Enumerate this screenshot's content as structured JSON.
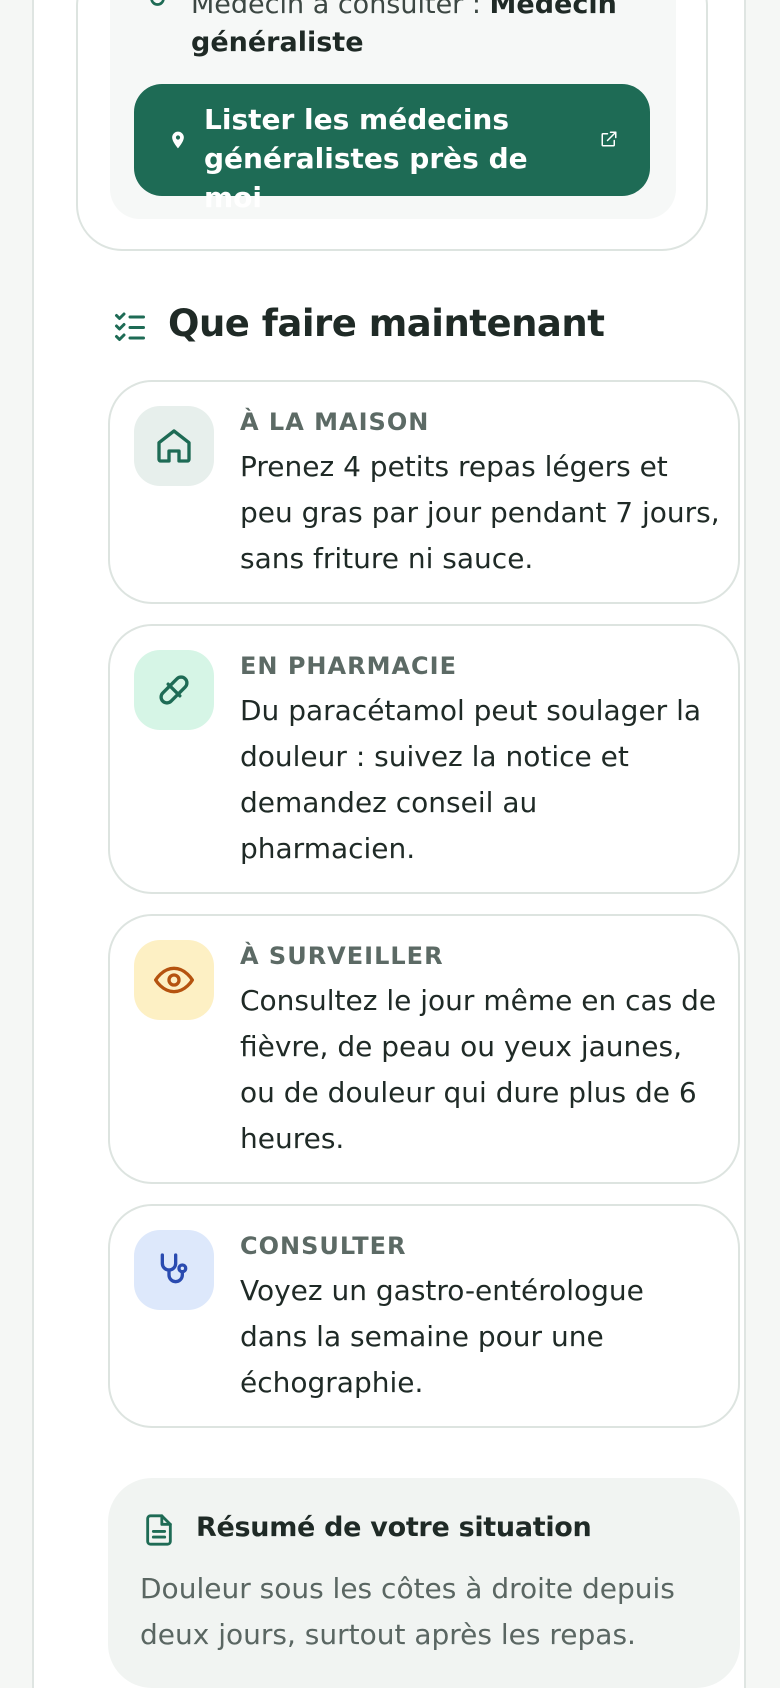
{
  "doctor_card": {
    "prefix": "Médecin à consulter : ",
    "specialty": "Médecin généraliste",
    "cta_label": "Lister les médecins généralistes près de moi"
  },
  "section": {
    "title": "Que faire maintenant"
  },
  "actions": [
    {
      "kicker": "À LA MAISON",
      "text": "Prenez 4 petits repas légers et peu gras par jour pendant 7 jours, sans friture ni sauce.",
      "icon": "home-icon",
      "icon_bg": "#e7efec",
      "icon_color": "#1e6b55"
    },
    {
      "kicker": "EN PHARMACIE",
      "text": "Du paracétamol peut soulager la douleur : suivez la notice et demandez conseil au pharmacien.",
      "icon": "pill-icon",
      "icon_bg": "#d6f5e6",
      "icon_color": "#1e6b55"
    },
    {
      "kicker": "À SURVEILLER",
      "text": "Consultez le jour même en cas de fièvre, de peau ou yeux jaunes, ou de douleur qui dure plus de 6 heures.",
      "icon": "eye-icon",
      "icon_bg": "#fdf0c4",
      "icon_color": "#b5530f"
    },
    {
      "kicker": "CONSULTER",
      "text": "Voyez un gastro-entérologue dans la semaine pour une échographie.",
      "icon": "stethoscope-icon",
      "icon_bg": "#dde8fb",
      "icon_color": "#2a4bb0"
    }
  ],
  "summary": {
    "title": "Résumé de votre situation",
    "text": "Douleur sous les côtes à droite depuis deux jours, surtout après les repas."
  },
  "colors": {
    "accent": "#1e6b55",
    "text": "#1f2a26",
    "muted": "#5c6a65"
  }
}
